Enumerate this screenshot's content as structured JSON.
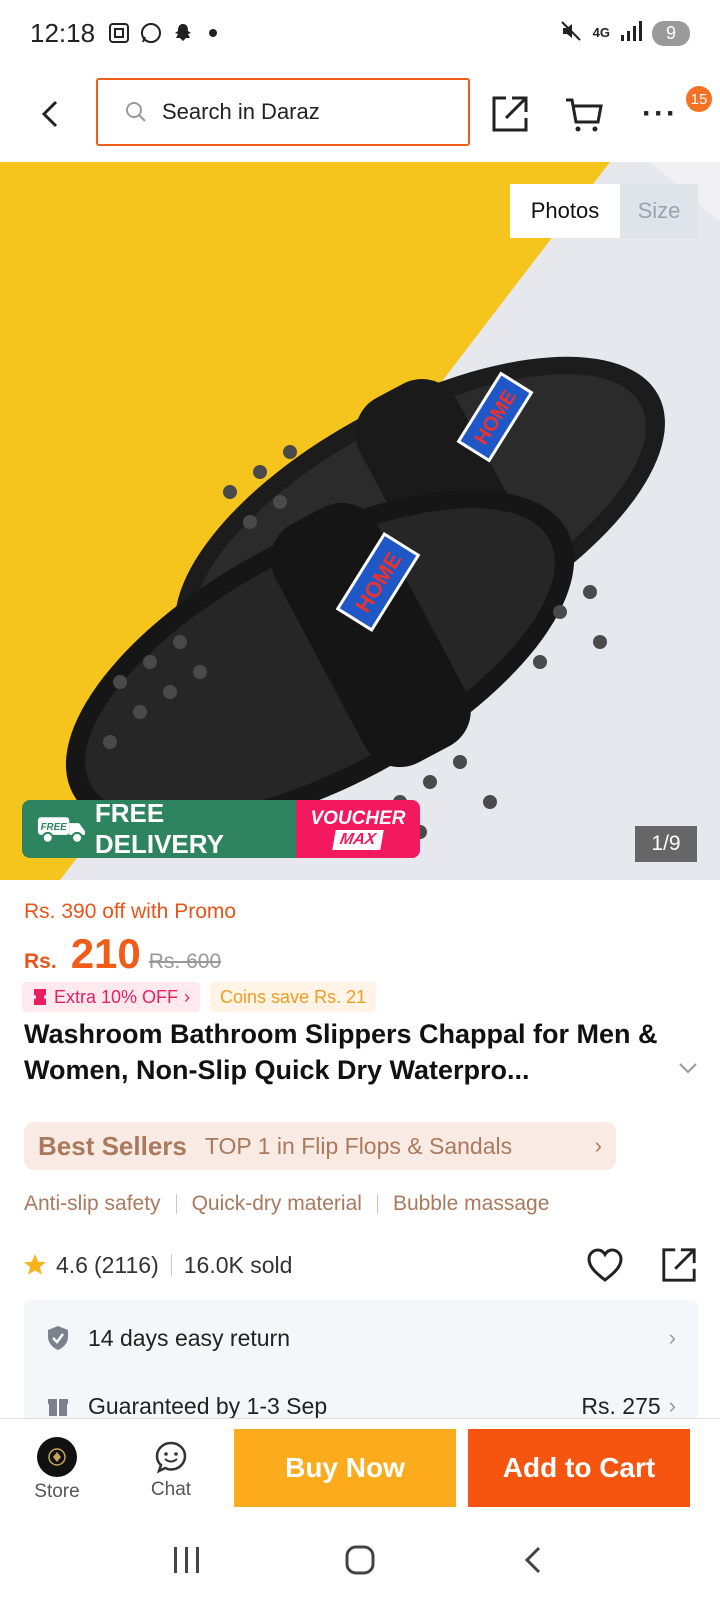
{
  "status_bar": {
    "time": "12:18",
    "network": "4G",
    "battery": "9"
  },
  "header": {
    "search_placeholder": "Search in Daraz",
    "more_badge": "15"
  },
  "gallery": {
    "tabs": [
      "Photos",
      "Size"
    ],
    "active_tab": "Photos",
    "counter": "1/9",
    "promo_free_label": "FREE DELIVERY",
    "promo_free_small": "FREE",
    "promo_voucher_top": "VOUCHER",
    "promo_voucher_bottom": "MAX",
    "product_print": "HOME"
  },
  "price": {
    "promo_line": "Rs. 390 off with Promo",
    "currency": "Rs.",
    "current": "210",
    "original": "Rs. 600",
    "extra_tag": "Extra 10% OFF",
    "coins_tag": "Coins save Rs. 21"
  },
  "product": {
    "title": "Washroom Bathroom Slippers Chappal for Men & Women, Non-Slip Quick Dry Waterpro..."
  },
  "bestseller": {
    "brand": "Best Sellers",
    "text": "TOP 1 in Flip Flops & Sandals"
  },
  "features": [
    "Anti-slip safety",
    "Quick-dry material",
    "Bubble massage"
  ],
  "rating": {
    "score": "4.6",
    "count": "(2116)",
    "sold": "16.0K sold"
  },
  "services": {
    "return_text": "14 days easy return",
    "delivery_text": "Guaranteed by 1-3 Sep",
    "delivery_price": "Rs. 275"
  },
  "bottom_bar": {
    "store_label": "Store",
    "chat_label": "Chat",
    "buy_now": "Buy Now",
    "add_to_cart": "Add to Cart"
  },
  "colors": {
    "accent": "#f5550f",
    "buy_now": "#fbab1c",
    "promo_green": "#2f8460",
    "voucher_pink": "#f2195f"
  }
}
